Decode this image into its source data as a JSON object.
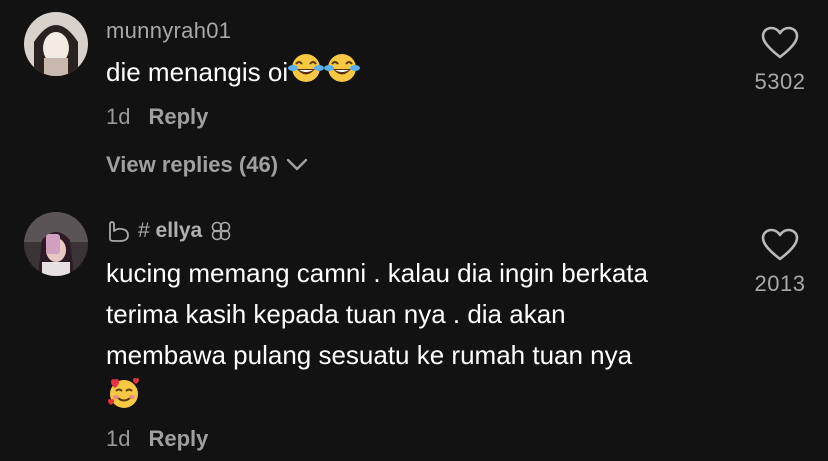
{
  "comments": [
    {
      "username": "munnyrah01",
      "text": "die menangis oi",
      "emojis": [
        "face-with-tears-of-joy-icon",
        "face-with-tears-of-joy-icon"
      ],
      "time": "1d",
      "reply_label": "Reply",
      "view_replies": "View replies (46)",
      "likes": "5302"
    },
    {
      "username_prefix": "# ",
      "username": "ellya",
      "text_lines": [
        "kucing memang camni . kalau dia ingin berkata",
        "terima kasih kepada tuan nya . dia akan",
        "membawa pulang sesuatu ke rumah tuan nya"
      ],
      "emojis": [
        "smiling-face-with-hearts-icon"
      ],
      "time": "1d",
      "reply_label": "Reply",
      "likes": "2013"
    }
  ],
  "colors": {
    "background": "#121212",
    "text_primary": "#ffffff",
    "text_secondary": "#a8a8a8"
  }
}
